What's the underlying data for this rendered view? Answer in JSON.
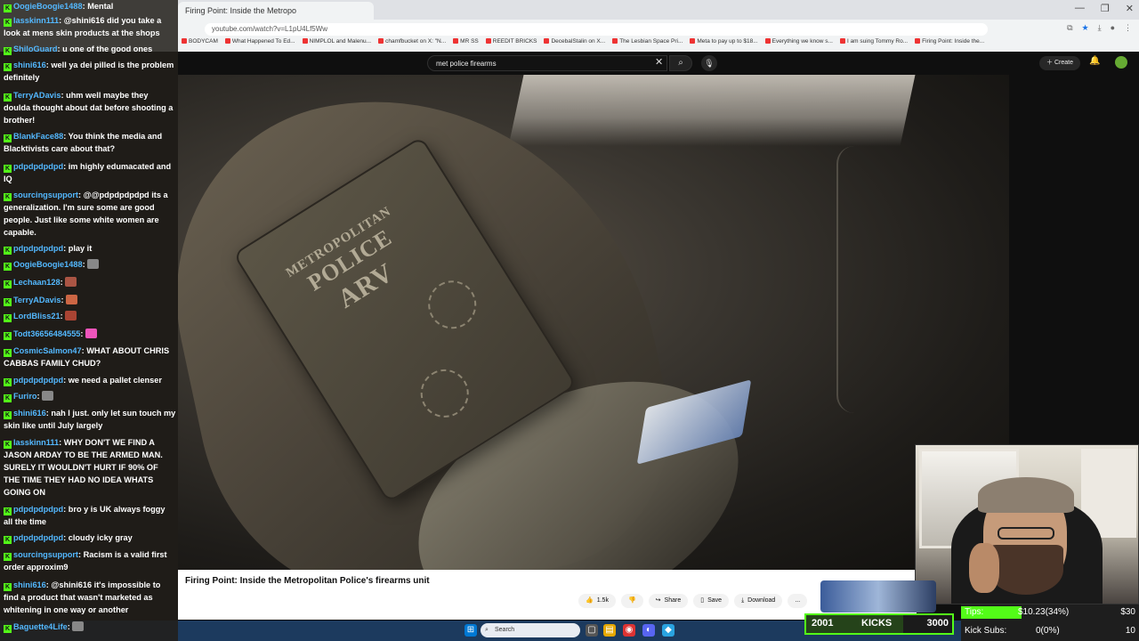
{
  "browser": {
    "tab_title": "Firing Point: Inside the Metropo",
    "url": "youtube.com/watch?v=L1pU4Lf5Ww",
    "window_controls": [
      "—",
      "❐",
      "✕"
    ],
    "bookmarks": [
      "BODYCAM",
      "What Happened To Ed...",
      "NIMPLOL and Malenu...",
      "chamfbucket on X: \"N...",
      "MR SS",
      "REEDIT BRICKS",
      "DecebalStalin on X...",
      "The Lesbian Space Pri...",
      "Meta to pay up to $18...",
      "Everything we know s...",
      "I am suing Tommy Ro...",
      "Firing Point: Inside the..."
    ]
  },
  "youtube": {
    "search_value": "met police firearms",
    "create_label": "Create",
    "video_title": "Firing Point: Inside the Metropolitan Police's firearms unit",
    "actions": [
      {
        "icon": "thumbs-up-icon",
        "label": "1.5k"
      },
      {
        "icon": "thumbs-down-icon",
        "label": ""
      },
      {
        "icon": "share-icon",
        "label": "Share"
      },
      {
        "icon": "save-icon",
        "label": "Save"
      },
      {
        "icon": "download-icon",
        "label": "Download"
      },
      {
        "icon": "more-icon",
        "label": "..."
      }
    ]
  },
  "video_frame": {
    "badge_line1": "METROPOLITAN",
    "badge_line2": "POLICE",
    "badge_line3": "ARV"
  },
  "chat": {
    "messages": [
      {
        "user": "OogieBoogie1488",
        "text": "Mental"
      },
      {
        "user": "lasskinn111",
        "text": "@shini616 did you take a look at mens skin products at the shops"
      },
      {
        "user": "ShiloGuard",
        "text": "u one of the good ones"
      },
      {
        "user": "shini616",
        "text": "well ya dei pilled is the problem definitely"
      },
      {
        "user": "TerryADavis",
        "text": "uhm well maybe they doulda thought about dat before shooting a brother!"
      },
      {
        "user": "BlankFace88",
        "text": "You think the media and Blacktivists care about that?"
      },
      {
        "user": "pdpdpdpdpd",
        "text": "im highly edumacated and IQ"
      },
      {
        "user": "sourcingsupport",
        "text": "@@pdpdpdpdpd its a generalization. I'm sure some are good people. Just like some white women are capable."
      },
      {
        "user": "pdpdpdpdpd",
        "text": "play it"
      },
      {
        "user": "OogieBoogie1488",
        "text": ""
      },
      {
        "user": "Lechaan128",
        "text": ""
      },
      {
        "user": "TerryADavis",
        "text": ""
      },
      {
        "user": "LordBliss21",
        "text": ""
      },
      {
        "user": "Todt36656484555",
        "text": ""
      },
      {
        "user": "CosmicSalmon47",
        "text": "WHAT ABOUT CHRIS CABBAS FAMILY CHUD?"
      },
      {
        "user": "pdpdpdpdpd",
        "text": "we need a pallet clenser"
      },
      {
        "user": "Furiro",
        "text": ""
      },
      {
        "user": "shini616",
        "text": "nah I just. only let sun touch my skin like until July largely"
      },
      {
        "user": "lasskinn111",
        "text": "WHY DON'T WE FIND A JASON ARDAY TO BE THE ARMED MAN. SURELY IT WOULDN'T HURT IF 90% OF THE TIME THEY HAD NO IDEA WHATS GOING ON"
      },
      {
        "user": "pdpdpdpdpd",
        "text": "bro y is UK always foggy all the time"
      },
      {
        "user": "pdpdpdpdpd",
        "text": "cloudy icky gray"
      },
      {
        "user": "sourcingsupport",
        "text": "Racism is a valid first order approxim9"
      },
      {
        "user": "shini616",
        "text": "@shini616 it's impossible to find a product that wasn't marketed as whitening in one way or another"
      },
      {
        "user": "Baguette4Life",
        "text": ""
      }
    ]
  },
  "taskbar": {
    "search_label": "Search"
  },
  "stream_overlay": {
    "kicks_current": "2001",
    "kicks_label": "KICKS",
    "kicks_goal": "3000",
    "kicks_progress": 0.667,
    "tips_label": "Tips:",
    "tips_value": "$10.23(34%)",
    "tips_goal": "$30",
    "tips_progress": 0.34,
    "subs_label": "Kick Subs:",
    "subs_value": "0(0%)",
    "subs_goal": "10"
  },
  "colors": {
    "kick_green": "#53fc18",
    "chat_username": "#53b8ff",
    "youtube_bg": "#0f0f0f"
  }
}
